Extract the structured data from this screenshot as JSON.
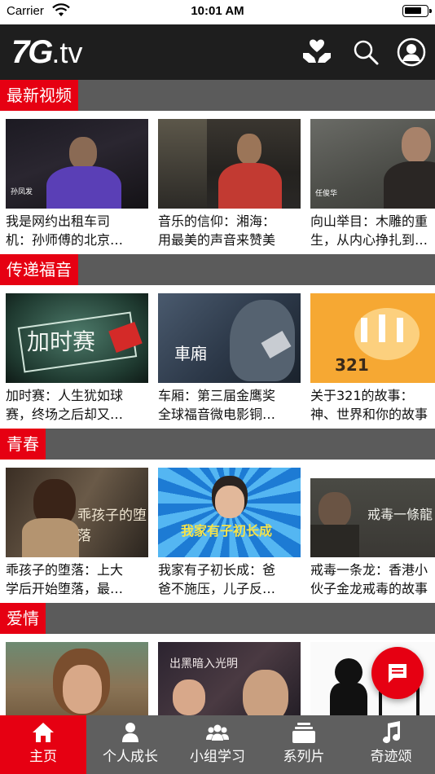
{
  "status_bar": {
    "carrier": "Carrier",
    "time": "10:01 AM"
  },
  "header": {
    "logo_main": "7G",
    "logo_suffix": ".tv",
    "icons": [
      "donate-icon",
      "search-icon",
      "user-icon"
    ]
  },
  "sections": [
    {
      "title": "最新视频",
      "items": [
        {
          "title_lines": [
            "我是网约出租车司",
            "机：孙师傅的北京…"
          ],
          "thumb_caption": "孙凤发"
        },
        {
          "title_lines": [
            "音乐的信仰：湘海：",
            "用最美的声音来赞美"
          ]
        },
        {
          "title_lines": [
            "向山举目：木雕的重",
            "生，从内心挣扎到…"
          ],
          "thumb_caption": "任俊华"
        }
      ]
    },
    {
      "title": "传递福音",
      "items": [
        {
          "title_lines": [
            "加时赛：人生犹如球",
            "赛，终场之后却又…"
          ],
          "thumb_caption": "加时赛"
        },
        {
          "title_lines": [
            "车厢：第三届金鹰奖",
            "全球福音微电影铜…"
          ],
          "thumb_caption": "車廂"
        },
        {
          "title_lines": [
            "关于321的故事：",
            "神、世界和你的故事"
          ],
          "thumb_caption": "321"
        }
      ]
    },
    {
      "title": "青春",
      "items": [
        {
          "title_lines": [
            "乖孩子的堕落：上大",
            "学后开始堕落，最…"
          ],
          "thumb_caption": "乖孩子的堕落"
        },
        {
          "title_lines": [
            "我家有子初长成：爸",
            "爸不施压，儿子反…"
          ],
          "thumb_caption": "我家有子初长成"
        },
        {
          "title_lines": [
            "戒毒一条龙：香港小",
            "伙子金龙戒毒的故事"
          ],
          "thumb_caption": "戒毒一條龍"
        }
      ]
    },
    {
      "title": "爱情",
      "items": [
        {
          "title_lines": [
            "",
            ""
          ]
        },
        {
          "title_lines": [
            "",
            ""
          ],
          "thumb_caption": "出黑暗入光明"
        },
        {
          "title_lines": [
            "",
            ""
          ]
        }
      ]
    }
  ],
  "fab": {
    "icon": "chat-icon"
  },
  "tabs": [
    {
      "label": "主页",
      "icon": "home-icon",
      "active": true
    },
    {
      "label": "个人成长",
      "icon": "person-icon",
      "active": false
    },
    {
      "label": "小组学习",
      "icon": "group-icon",
      "active": false
    },
    {
      "label": "系列片",
      "icon": "stack-icon",
      "active": false
    },
    {
      "label": "奇迹颂",
      "icon": "music-note-icon",
      "active": false
    }
  ],
  "colors": {
    "accent": "#e60012",
    "header_bg": "#1e1e1e",
    "section_bar": "#5b5b5b",
    "tab_bar": "#5f5f5f"
  }
}
